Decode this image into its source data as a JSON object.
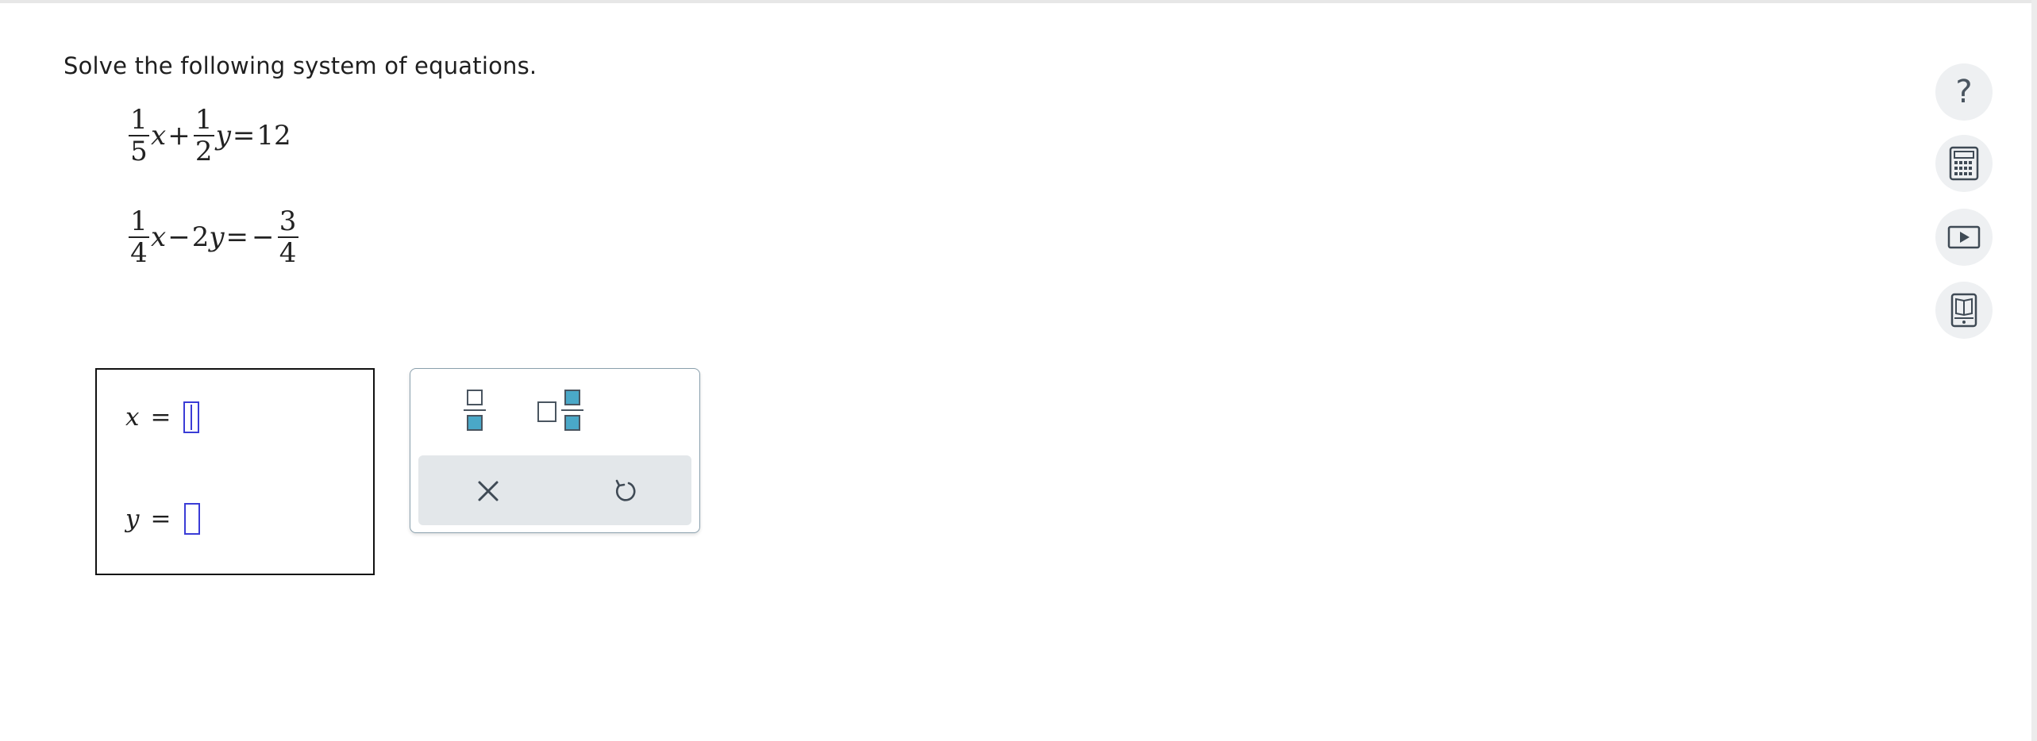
{
  "question": {
    "prompt": "Solve the following system of equations."
  },
  "equations": {
    "eq1": {
      "frac_a": {
        "num": "1",
        "den": "5"
      },
      "var_a": "x",
      "op1": "+",
      "frac_b": {
        "num": "1",
        "den": "2"
      },
      "var_b": "y",
      "rel": "=",
      "rhs": "12"
    },
    "eq2": {
      "frac_a": {
        "num": "1",
        "den": "4"
      },
      "var_a": "x",
      "op1": "−",
      "coef_b": "2",
      "var_b": "y",
      "rel": "=",
      "neg": "−",
      "rhs_frac": {
        "num": "3",
        "den": "4"
      }
    }
  },
  "answer": {
    "x_label": "x",
    "y_label": "y",
    "equals": "=",
    "x_value": "",
    "y_value": ""
  },
  "palette": {
    "buttons": [
      "fraction-icon",
      "mixed-number-icon"
    ],
    "actions": [
      "close-icon",
      "undo-icon"
    ]
  },
  "side_tools": {
    "help_glyph": "?",
    "icons": [
      "help-icon",
      "calculator-icon",
      "video-icon",
      "textbook-icon"
    ]
  },
  "colors": {
    "accent": "#3a3cd6",
    "palette_box_fill": "#4aa8c8",
    "action_bar": "#e3e7ea",
    "side_button_bg": "#eef0f2"
  }
}
